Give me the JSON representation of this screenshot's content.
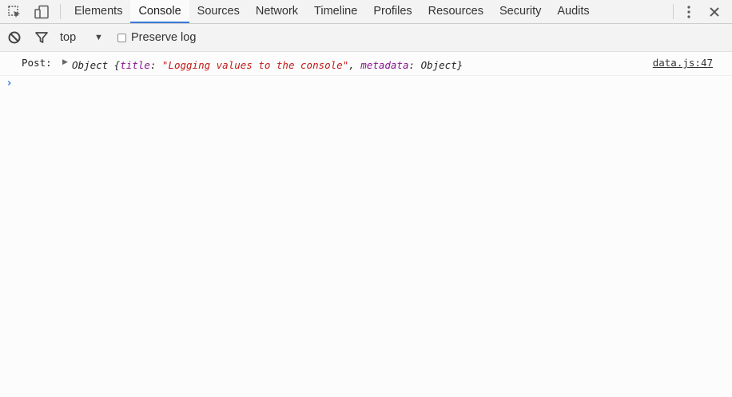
{
  "tabs": [
    {
      "label": "Elements"
    },
    {
      "label": "Console"
    },
    {
      "label": "Sources"
    },
    {
      "label": "Network"
    },
    {
      "label": "Timeline"
    },
    {
      "label": "Profiles"
    },
    {
      "label": "Resources"
    },
    {
      "label": "Security"
    },
    {
      "label": "Audits"
    }
  ],
  "active_tab": "Console",
  "accent_color": "#3879d9",
  "toolbar": {
    "context": "top",
    "preserve_log_label": "Preserve log",
    "preserve_log_checked": false
  },
  "console": {
    "messages": [
      {
        "prefix": "Post:",
        "type_name": "Object",
        "key1": "title",
        "value1": "\"Logging values to the console\"",
        "key2": "metadata",
        "value2": "Object",
        "source": "data.js:47"
      }
    ]
  },
  "icons": [
    "inspect-element-icon",
    "device-mode-icon",
    "more-vertical-icon",
    "close-icon",
    "clear-console-icon",
    "filter-icon",
    "dropdown-arrow-icon",
    "expand-triangle-icon",
    "prompt-chevron-icon"
  ]
}
